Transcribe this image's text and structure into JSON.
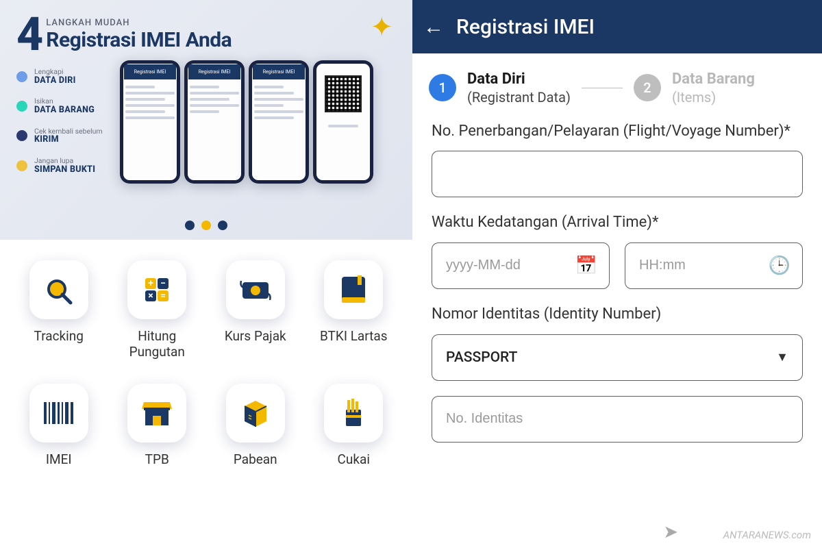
{
  "banner": {
    "big_number": "4",
    "subtitle": "LANGKAH MUDAH",
    "title": "Registrasi IMEI Anda",
    "steps": [
      {
        "top": "Lengkapi",
        "bot": "DATA DIRI"
      },
      {
        "top": "Isikan",
        "bot": "DATA BARANG"
      },
      {
        "top": "Cek kembali sebelum",
        "bot": "KIRIM"
      },
      {
        "top": "Jangan lupa",
        "bot": "SIMPAN BUKTI"
      }
    ]
  },
  "tiles": [
    {
      "label": "Tracking"
    },
    {
      "label": "Hitung\nPungutan"
    },
    {
      "label": "Kurs Pajak"
    },
    {
      "label": "BTKI Lartas"
    },
    {
      "label": "IMEI"
    },
    {
      "label": "TPB"
    },
    {
      "label": "Pabean"
    },
    {
      "label": "Cukai"
    }
  ],
  "form": {
    "app_title": "Registrasi IMEI",
    "stepper": {
      "s1_num": "1",
      "s1_l1": "Data Diri",
      "s1_l2": "(Registrant Data)",
      "s2_num": "2",
      "s2_l1": "Data Barang",
      "s2_l2": "(Items)"
    },
    "flight_label": "No. Penerbangan/Pelayaran (Flight/Voyage Number)*",
    "arrival_label": "Waktu Kedatangan (Arrival Time)*",
    "date_placeholder": "yyyy-MM-dd",
    "time_placeholder": "HH:mm",
    "identity_label": "Nomor Identitas (Identity Number)",
    "identity_type": "PASSPORT",
    "identity_num_placeholder": "No. Identitas"
  },
  "watermark": "ANTARANEWS.com"
}
